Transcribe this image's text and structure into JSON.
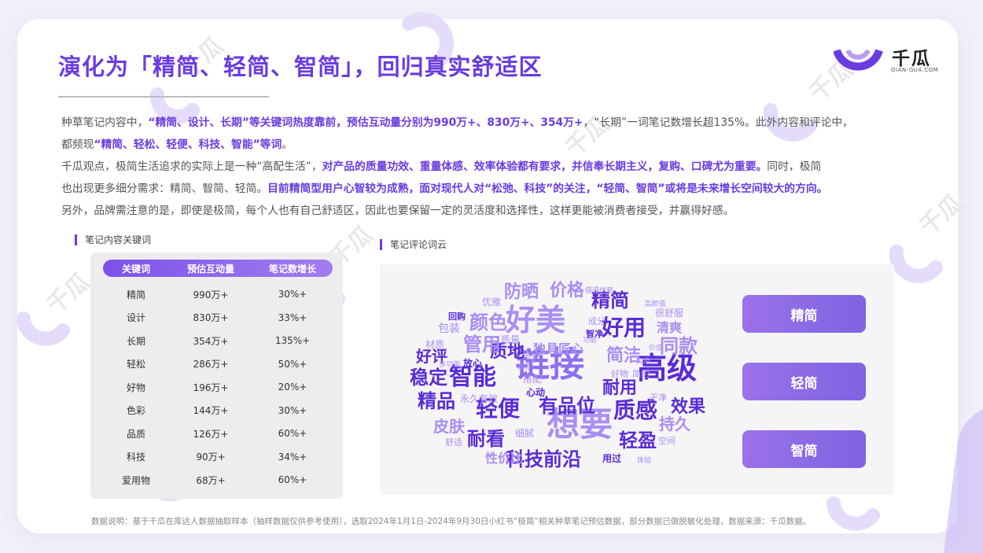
{
  "title": "演化为「精简、轻简、智简」，回归真实舒适区",
  "brand": {
    "name": "千瓜",
    "url_text": "QIAN-GUA.COM",
    "accent": "#6a3ce0"
  },
  "paragraphs": {
    "p1": [
      {
        "t": "种草笔记内容中，",
        "h": false
      },
      {
        "t": "“精简、设计、长期”等关键词热度靠前，预估互动量分别为990万+、830万+、354万+",
        "h": true
      },
      {
        "t": "，“长期”一词笔记数增长超135%。此外内容和评论中，",
        "h": false
      }
    ],
    "p2": [
      {
        "t": "都频现",
        "h": false
      },
      {
        "t": "“精简、轻松、轻便、科技、智能”等词",
        "h": true
      },
      {
        "t": "。",
        "h": false
      }
    ],
    "p3": [
      {
        "t": "千瓜观点，极简生活追求的实际上是一种“高配生活”，",
        "h": false
      },
      {
        "t": "对产品的质量功效、重量体感、效率体验都有要求，并信奉长期主义，复购、口碑尤为重要。",
        "h": true
      },
      {
        "t": "同时，极简",
        "h": false
      }
    ],
    "p4": [
      {
        "t": "也出现更多细分需求：精简、智简、轻简。",
        "h": false
      },
      {
        "t": "目前精简型用户心智较为成熟，面对现代人对“松弛、科技”的关注，“轻简、智简”或将是未来增长空间较大的方向。",
        "h": true
      }
    ],
    "p5": [
      {
        "t": "另外，品牌需注意的是，即使是极简，每个人也有自己舒适区，因此也要保留一定的灵活度和选择性，这样更能被消费者接受，并赢得好感。",
        "h": false
      }
    ]
  },
  "keyword_section": {
    "label": "笔记内容关键词",
    "headers": [
      "关键词",
      "预估互动量",
      "笔记数增长"
    ],
    "rows": [
      [
        "精简",
        "990万+",
        "30%+"
      ],
      [
        "设计",
        "830万+",
        "33%+"
      ],
      [
        "长期",
        "354万+",
        "135%+"
      ],
      [
        "轻松",
        "286万+",
        "50%+"
      ],
      [
        "好物",
        "196万+",
        "20%+"
      ],
      [
        "色彩",
        "144万+",
        "30%+"
      ],
      [
        "品质",
        "126万+",
        "60%+"
      ],
      [
        "科技",
        "90万+",
        "34%+"
      ],
      [
        "爱用物",
        "68万+",
        "60%+"
      ]
    ]
  },
  "cloud_section": {
    "label": "笔记评论词云",
    "words": [
      {
        "t": "链接",
        "c": "#8b6ff0",
        "w": "bold"
      },
      {
        "t": "高级",
        "c": "#5b2bd8",
        "w": "bold"
      },
      {
        "t": "想要",
        "c": "#a98ef3",
        "w": "bold"
      },
      {
        "t": "好美",
        "c": "#a98ef3",
        "w": "bold"
      },
      {
        "t": "智能",
        "c": "#5b2bd8",
        "w": "bold"
      },
      {
        "t": "科技前沿",
        "c": "#5b2bd8",
        "w": "bold"
      },
      {
        "t": "精简",
        "c": "#5b2bd8",
        "w": "bold"
      },
      {
        "t": "好用",
        "c": "#5b2bd8",
        "w": "bold"
      },
      {
        "t": "质感",
        "c": "#5b2bd8",
        "w": "bold"
      },
      {
        "t": "轻便",
        "c": "#5b2bd8",
        "w": "bold"
      },
      {
        "t": "耐看",
        "c": "#5b2bd8",
        "w": "bold"
      },
      {
        "t": "轻盈",
        "c": "#5b2bd8",
        "w": "bold"
      },
      {
        "t": "精品",
        "c": "#5b2bd8",
        "w": "bold"
      },
      {
        "t": "稳定",
        "c": "#5b2bd8",
        "w": "bold"
      },
      {
        "t": "质地",
        "c": "#5b2bd8",
        "w": "bold"
      },
      {
        "t": "价格",
        "c": "#a98ef3",
        "w": "bold"
      },
      {
        "t": "颜色",
        "c": "#a98ef3",
        "w": "bold"
      },
      {
        "t": "防晒",
        "c": "#a98ef3",
        "w": "bold"
      },
      {
        "t": "管用",
        "c": "#a98ef3",
        "w": "bold"
      },
      {
        "t": "同款",
        "c": "#a98ef3",
        "w": "bold"
      },
      {
        "t": "简洁",
        "c": "#a98ef3",
        "w": "bold"
      },
      {
        "t": "耐用",
        "c": "#5b2bd8",
        "w": "bold"
      },
      {
        "t": "效果",
        "c": "#5b2bd8",
        "w": "bold"
      },
      {
        "t": "有品位",
        "c": "#5b2bd8",
        "w": "bold"
      },
      {
        "t": "好评",
        "c": "#5b2bd8",
        "w": "bold"
      },
      {
        "t": "持久",
        "c": "#a98ef3",
        "w": "bold"
      },
      {
        "t": "皮肤",
        "c": "#a98ef3",
        "w": "bold"
      },
      {
        "t": "独具匠心",
        "c": "#a98ef3",
        "w": "bold"
      },
      {
        "t": "清爽",
        "c": "#a98ef3",
        "w": "bold"
      },
      {
        "t": "性价比",
        "c": "#a98ef3",
        "w": "bold"
      },
      {
        "t": "很舒服",
        "c": "#a98ef3",
        "w": "normal"
      },
      {
        "t": "包装",
        "c": "#a98ef3",
        "w": "normal"
      },
      {
        "t": "材质",
        "c": "#a98ef3",
        "w": "normal"
      },
      {
        "t": "优雅",
        "c": "#a98ef3",
        "w": "normal"
      },
      {
        "t": "回购",
        "c": "#5b2bd8",
        "w": "bold"
      },
      {
        "t": "质量",
        "c": "#a98ef3",
        "w": "normal"
      },
      {
        "t": "成分",
        "c": "#a98ef3",
        "w": "normal"
      },
      {
        "t": "智净",
        "c": "#5b2bd8",
        "w": "bold"
      },
      {
        "t": "放心",
        "c": "#5b2bd8",
        "w": "bold"
      },
      {
        "t": "搭配",
        "c": "#a98ef3",
        "w": "normal"
      },
      {
        "t": "心动",
        "c": "#5b2bd8",
        "w": "bold"
      },
      {
        "t": "好物",
        "c": "#a98ef3",
        "w": "normal"
      },
      {
        "t": "简约",
        "c": "#a98ef3",
        "w": "normal"
      },
      {
        "t": "永久有效",
        "c": "#a98ef3",
        "w": "normal"
      },
      {
        "t": "干净",
        "c": "#a98ef3",
        "w": "normal"
      },
      {
        "t": "细腻",
        "c": "#a98ef3",
        "w": "normal"
      },
      {
        "t": "舒适",
        "c": "#a98ef3",
        "w": "normal"
      },
      {
        "t": "用过",
        "c": "#5b2bd8",
        "w": "bold"
      },
      {
        "t": "空间",
        "c": "#a98ef3",
        "w": "normal"
      },
      {
        "t": "值得信赖",
        "c": "#a98ef3",
        "w": "normal"
      },
      {
        "t": "高颜值",
        "c": "#a98ef3",
        "w": "normal"
      },
      {
        "t": "价值",
        "c": "#a98ef3",
        "w": "normal"
      },
      {
        "t": "实用",
        "c": "#a98ef3",
        "w": "normal"
      },
      {
        "t": "多功能",
        "c": "#a98ef3",
        "w": "normal"
      },
      {
        "t": "治愈",
        "c": "#a98ef3",
        "w": "normal"
      },
      {
        "t": "功能",
        "c": "#a98ef3",
        "w": "normal"
      },
      {
        "t": "简单",
        "c": "#a98ef3",
        "w": "normal"
      },
      {
        "t": "体验",
        "c": "#a98ef3",
        "w": "normal"
      }
    ]
  },
  "tags": [
    "精简",
    "轻简",
    "智简"
  ],
  "footnote": "数据说明：基于千瓜在库达人数据抽取样本（抽样数据仅供参考使用），选取2024年1月1日-2024年9月30日小红书“极简”相关种草笔记预估数据，部分数据已做脱敏化处理，数据来源：千瓜数据。"
}
